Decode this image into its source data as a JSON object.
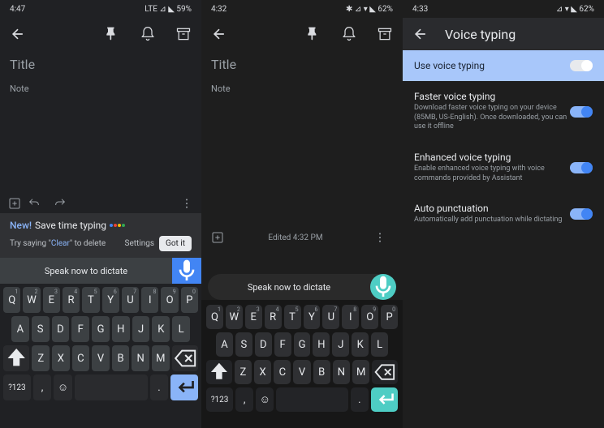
{
  "p1": {
    "status": {
      "time": "4:47",
      "icons": "LTE ⊿ ◣ 59%"
    },
    "title_placeholder": "Title",
    "note_placeholder": "Note",
    "banner": {
      "new": "New!",
      "headline": "Save time typing",
      "try_prefix": "Try saying \"",
      "clear": "Clear",
      "try_suffix": "\" to delete",
      "settings": "Settings",
      "gotit": "Got it"
    },
    "speak_text": "Speak now to dictate",
    "keyboard": {
      "row1": [
        "Q",
        "W",
        "E",
        "R",
        "T",
        "Y",
        "U",
        "I",
        "O",
        "P"
      ],
      "row1_sup": [
        "1",
        "2",
        "3",
        "4",
        "5",
        "6",
        "7",
        "8",
        "9",
        "0"
      ],
      "row2": [
        "A",
        "S",
        "D",
        "F",
        "G",
        "H",
        "J",
        "K",
        "L"
      ],
      "row3": [
        "Z",
        "X",
        "C",
        "V",
        "B",
        "N",
        "M"
      ],
      "sym": "?123",
      "comma": ",",
      "period": "."
    }
  },
  "p2": {
    "status": {
      "time": "4:32",
      "icons": "✱ ⊿ ▾ ◣ 62%"
    },
    "title_placeholder": "Title",
    "note_placeholder": "Note",
    "edited": "Edited 4:32 PM",
    "speak_text": "Speak now to dictate",
    "keyboard": {
      "row1": [
        "Q",
        "W",
        "E",
        "R",
        "T",
        "Y",
        "U",
        "I",
        "O",
        "P"
      ],
      "row1_sup": [
        "1",
        "2",
        "3",
        "4",
        "5",
        "6",
        "7",
        "8",
        "9",
        "0"
      ],
      "row2": [
        "A",
        "S",
        "D",
        "F",
        "G",
        "H",
        "J",
        "K",
        "L"
      ],
      "row3": [
        "Z",
        "X",
        "C",
        "V",
        "B",
        "N",
        "M"
      ],
      "sym": "?123",
      "comma": ",",
      "period": "."
    }
  },
  "p3": {
    "status": {
      "time": "4:33",
      "icons": "⊿ ▾ ◣ 62%"
    },
    "page_title": "Voice typing",
    "settings": [
      {
        "title": "Use voice typing",
        "sub": "",
        "on": true,
        "highlight": true
      },
      {
        "title": "Faster voice typing",
        "sub": "Download faster voice typing on your device (85MB, US-English). Once downloaded, you can use it offline",
        "on": true,
        "highlight": false
      },
      {
        "title": "Enhanced voice typing",
        "sub": "Enable enhanced voice typing with voice commands provided by Assistant",
        "on": true,
        "highlight": false
      },
      {
        "title": "Auto punctuation",
        "sub": "Automatically add punctuation while dictating",
        "on": true,
        "highlight": false
      }
    ]
  }
}
